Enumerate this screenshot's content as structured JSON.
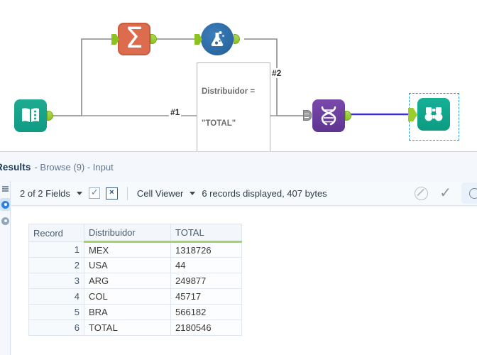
{
  "canvas": {
    "tools": [
      {
        "name": "input-data-tool",
        "label": "Input Data",
        "icon": "book-icon",
        "color": "#16a085"
      },
      {
        "name": "summarize-tool",
        "label": "Summarize",
        "icon": "sigma-icon",
        "color": "#dd6b4d",
        "glyph": "Σ"
      },
      {
        "name": "filter-tool",
        "label": "Filter",
        "icon": "flask-icon",
        "color": "#2a6ca8"
      },
      {
        "name": "union-tool",
        "label": "Union",
        "icon": "dna-icon",
        "color": "#6b3e9e"
      },
      {
        "name": "browse-tool",
        "label": "Browse",
        "icon": "binoculars-icon",
        "color": "#12a78d"
      }
    ],
    "annotation": {
      "line1": "Distribuidor =",
      "line2": "\"TOTAL\""
    },
    "connection_labels": {
      "first": "#1",
      "second": "#2"
    },
    "selected_connection_color": "#3b2fd0",
    "selection_border_color": "#2196f3"
  },
  "results": {
    "title": "Results",
    "subtitle": "- Browse (9) - Input",
    "toolbar": {
      "fields_label": "2 of 2 Fields",
      "check_glyph": "✓",
      "deselect_glyph": "×",
      "view_mode": "Cell Viewer",
      "status": "6 records displayed, 407 bytes",
      "ban_icon": "no-entry-icon",
      "check_icon": "checkmark-icon",
      "search_icon": "search-icon"
    },
    "grid": {
      "columns": [
        "Record",
        "Distribuidor",
        "TOTAL"
      ],
      "header_accent": "#9fd36b",
      "rows": [
        {
          "record": "1",
          "distribuidor": "MEX",
          "total": "1318726"
        },
        {
          "record": "2",
          "distribuidor": "USA",
          "total": "44"
        },
        {
          "record": "3",
          "distribuidor": "ARG",
          "total": "249877"
        },
        {
          "record": "4",
          "distribuidor": "COL",
          "total": "45717"
        },
        {
          "record": "5",
          "distribuidor": "BRA",
          "total": "566182"
        },
        {
          "record": "6",
          "distribuidor": "TOTAL",
          "total": "2180546"
        }
      ]
    },
    "rail": {
      "icons": [
        "list-icon",
        "record-selected-icon",
        "record-icon"
      ]
    }
  }
}
